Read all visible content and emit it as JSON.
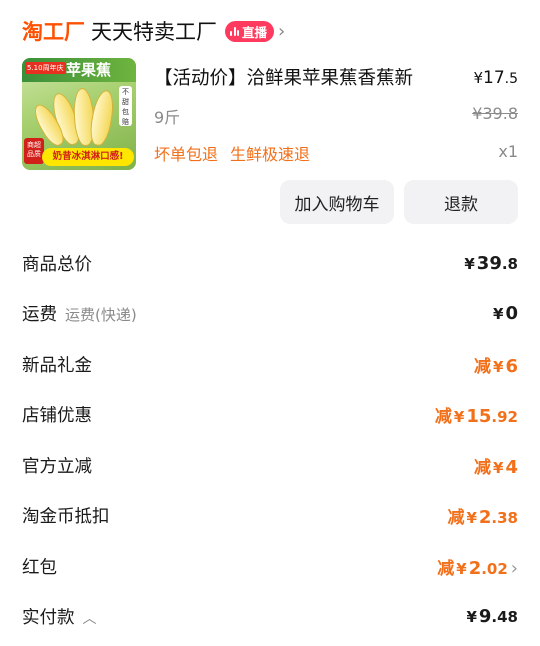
{
  "header": {
    "logo": "淘工厂",
    "store_name": "天天特卖工厂",
    "live_badge": "直播"
  },
  "product": {
    "image_text": {
      "promo_tag": "5.10周年庆",
      "banner_title": "苹果蕉",
      "side_tag": "不甜包赔",
      "corner_tag": "商超品质",
      "bottom_slogan": "奶昔冰淇淋口感!"
    },
    "title": "【活动价】洽鲜果苹果蕉香蕉新",
    "price_currency": "¥",
    "price_int": "17",
    "price_dec": ".5",
    "spec": "9斤",
    "original_price": "¥39.8",
    "tags": [
      "坏单包退",
      "生鲜极速退"
    ],
    "quantity": "x1"
  },
  "actions": {
    "add_to_cart": "加入购物车",
    "refund": "退款"
  },
  "summary": {
    "rows": [
      {
        "label": "商品总价",
        "sublabel": "",
        "prefix": "",
        "currency": "¥",
        "int": "39",
        "dec": ".8",
        "discount": false
      },
      {
        "label": "运费",
        "sublabel": "运费(快递)",
        "prefix": "",
        "currency": "¥",
        "int": "0",
        "dec": "",
        "discount": false
      },
      {
        "label": "新品礼金",
        "sublabel": "",
        "prefix": "减",
        "currency": "¥",
        "int": "6",
        "dec": "",
        "discount": true
      },
      {
        "label": "店铺优惠",
        "sublabel": "",
        "prefix": "减",
        "currency": "¥",
        "int": "15",
        "dec": ".92",
        "discount": true
      },
      {
        "label": "官方立减",
        "sublabel": "",
        "prefix": "减",
        "currency": "¥",
        "int": "4",
        "dec": "",
        "discount": true
      },
      {
        "label": "淘金币抵扣",
        "sublabel": "",
        "prefix": "减",
        "currency": "¥",
        "int": "2",
        "dec": ".38",
        "discount": true
      },
      {
        "label": "红包",
        "sublabel": "",
        "prefix": "减",
        "currency": "¥",
        "int": "2",
        "dec": ".02",
        "discount": true
      },
      {
        "label": "实付款",
        "sublabel": "",
        "prefix": "",
        "currency": "¥",
        "int": "9",
        "dec": ".48",
        "discount": false
      }
    ]
  },
  "colors": {
    "brand": "#ff5000",
    "discount": "#f2701a",
    "live_badge": "#ff3a5e"
  },
  "icons": [
    "chevron-right-icon",
    "chevron-up-icon",
    "live-bars-icon"
  ]
}
